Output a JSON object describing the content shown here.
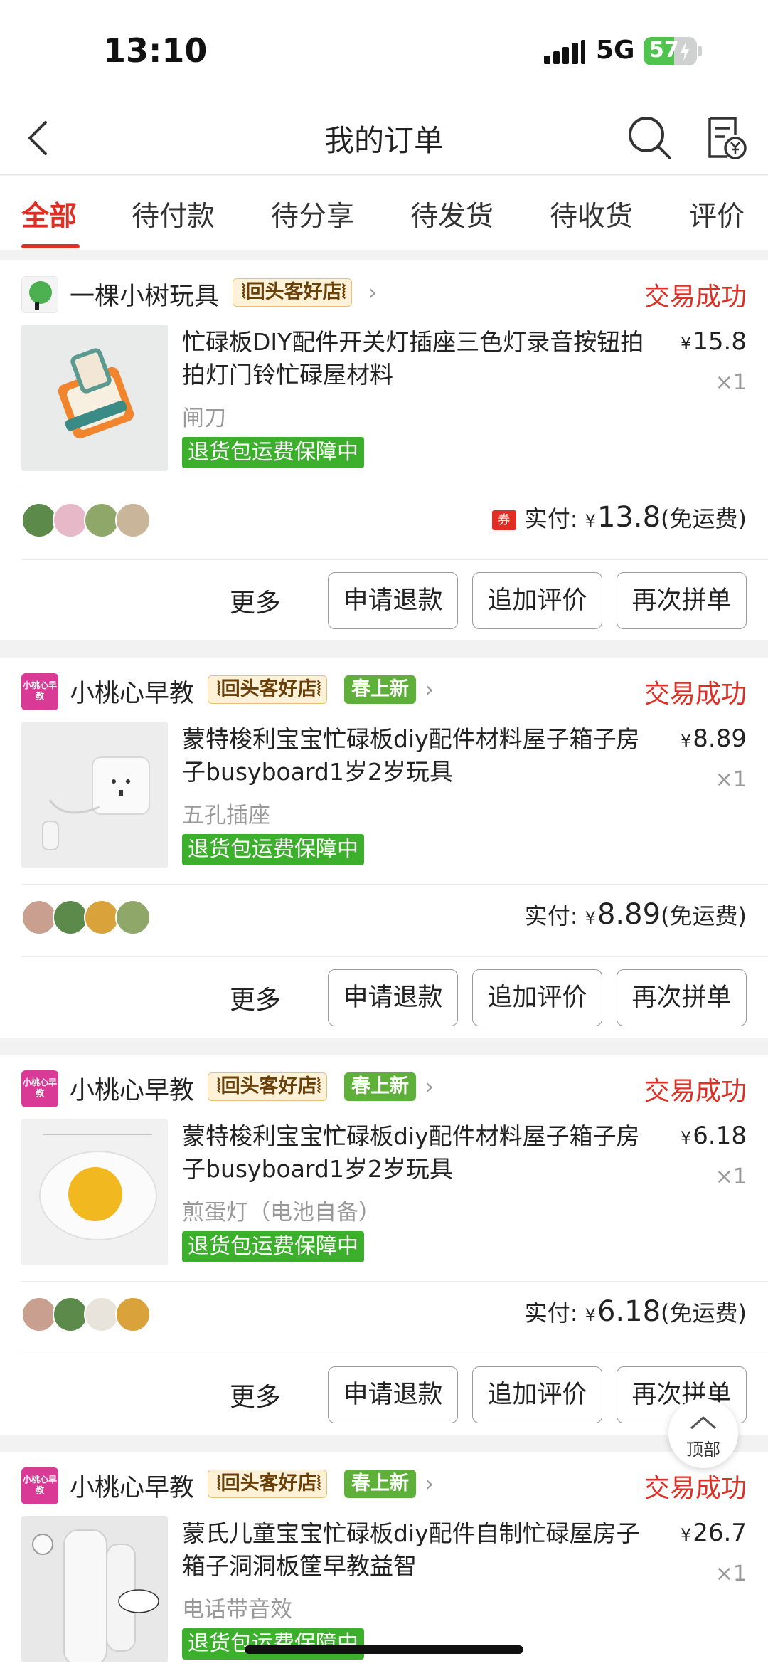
{
  "status_bar": {
    "time": "13:10",
    "network": "5G",
    "battery": "57",
    "battery_level": 0.57
  },
  "nav": {
    "title": "我的订单",
    "back_icon": "chevron-left-icon",
    "search_icon": "search-icon",
    "bill_icon": "bill-icon"
  },
  "tabs": [
    {
      "label": "全部",
      "active": true
    },
    {
      "label": "待付款"
    },
    {
      "label": "待分享"
    },
    {
      "label": "待发货"
    },
    {
      "label": "待收货"
    },
    {
      "label": "评价"
    }
  ],
  "orders": [
    {
      "shop_name": "一棵小树玩具",
      "shop_badges": [
        "⦚回头客好店⦚"
      ],
      "status": "交易成功",
      "title": "忙碌板DIY配件开关灯插座三色灯录音按钮拍拍灯门铃忙碌屋材料",
      "price_currency": "¥",
      "price": "15.8",
      "qty": "×1",
      "spec": "闸刀",
      "guarantee": "退货包运费保障中",
      "coupon": "券",
      "pay_label": "实付:",
      "pay_currency": "¥",
      "pay_amount": "13.8",
      "pay_note": "(免运费)",
      "more": "更多",
      "actions": [
        "申请退款",
        "追加评价",
        "再次拼单"
      ]
    },
    {
      "shop_name": "小桃心早教",
      "shop_logo_text": "小桃心早教",
      "shop_badges": [
        "⦚回头客好店⦚",
        "春上新"
      ],
      "status": "交易成功",
      "title": "蒙特梭利宝宝忙碌板diy配件材料屋子箱子房子busyboard1岁2岁玩具",
      "price_currency": "¥",
      "price": "8.89",
      "qty": "×1",
      "spec": "五孔插座",
      "guarantee": "退货包运费保障中",
      "pay_label": "实付:",
      "pay_currency": "¥",
      "pay_amount": "8.89",
      "pay_note": "(免运费)",
      "more": "更多",
      "actions": [
        "申请退款",
        "追加评价",
        "再次拼单"
      ]
    },
    {
      "shop_name": "小桃心早教",
      "shop_logo_text": "小桃心早教",
      "shop_badges": [
        "⦚回头客好店⦚",
        "春上新"
      ],
      "status": "交易成功",
      "title": "蒙特梭利宝宝忙碌板diy配件材料屋子箱子房子busyboard1岁2岁玩具",
      "price_currency": "¥",
      "price": "6.18",
      "qty": "×1",
      "spec": "煎蛋灯（电池自备）",
      "guarantee": "退货包运费保障中",
      "pay_label": "实付:",
      "pay_currency": "¥",
      "pay_amount": "6.18",
      "pay_note": "(免运费)",
      "more": "更多",
      "actions": [
        "申请退款",
        "追加评价",
        "再次拼单"
      ]
    },
    {
      "shop_name": "小桃心早教",
      "shop_logo_text": "小桃心早教",
      "shop_badges": [
        "⦚回头客好店⦚",
        "春上新"
      ],
      "status": "交易成功",
      "title": "蒙氏儿童宝宝忙碌板diy配件自制忙碌屋房子箱子洞洞板筐早教益智",
      "price_currency": "¥",
      "price": "26.7",
      "qty": "×1",
      "spec": "电话带音效",
      "guarantee": "退货包运费保障中"
    }
  ],
  "to_top": {
    "label": "顶部",
    "icon": "arrow-up-icon"
  },
  "colors": {
    "accent": "#e02e24",
    "guarantee": "#3cb02c",
    "spring_badge": "#5fb03a"
  }
}
